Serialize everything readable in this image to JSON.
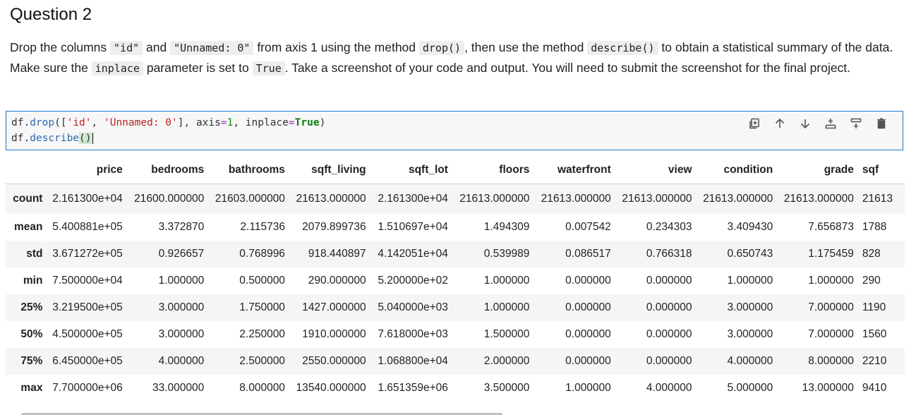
{
  "question": {
    "title": "Question 2",
    "body": {
      "t1": "Drop the columns ",
      "c1": "\"id\"",
      "t2": " and ",
      "c2": "\"Unnamed: 0\"",
      "t3": " from axis 1 using the method ",
      "c3": "drop()",
      "t4": ", then use the method ",
      "c4": "describe()",
      "t5": " to obtain a statistical summary of the data. Make sure the ",
      "c5": "inplace",
      "t6": " parameter is set to ",
      "c6": "True",
      "t7": ". Take a screenshot of your code and output. You will need to submit the screenshot for the final project."
    }
  },
  "code_cell": {
    "line1": {
      "var": "df",
      "dot": ".",
      "fn": "drop",
      "p1": "([",
      "s1": "'id'",
      "comma1": ", ",
      "s2": "'Unnamed: 0'",
      "p2": "], axis",
      "eq1": "=",
      "n1": "1",
      "p3": ", inplace",
      "eq2": "=",
      "kw": "True",
      "p4": ")"
    },
    "line2": {
      "var": "df",
      "dot": ".",
      "fn": "describe",
      "p1": "()"
    },
    "toolbar": [
      {
        "name": "duplicate-cell-button",
        "icon": "duplicate-icon"
      },
      {
        "name": "move-up-button",
        "icon": "arrow-up-icon"
      },
      {
        "name": "move-down-button",
        "icon": "arrow-down-icon"
      },
      {
        "name": "insert-above-button",
        "icon": "insert-above-icon"
      },
      {
        "name": "insert-below-button",
        "icon": "insert-below-icon"
      },
      {
        "name": "delete-cell-button",
        "icon": "trash-icon"
      }
    ]
  },
  "output_table": {
    "columns": [
      "",
      "price",
      "bedrooms",
      "bathrooms",
      "sqft_living",
      "sqft_lot",
      "floors",
      "waterfront",
      "view",
      "condition",
      "grade",
      "sqf"
    ],
    "rows": [
      {
        "label": "count",
        "values": [
          "2.161300e+04",
          "21600.000000",
          "21603.000000",
          "21613.000000",
          "2.161300e+04",
          "21613.000000",
          "21613.000000",
          "21613.000000",
          "21613.000000",
          "21613.000000",
          "21613"
        ]
      },
      {
        "label": "mean",
        "values": [
          "5.400881e+05",
          "3.372870",
          "2.115736",
          "2079.899736",
          "1.510697e+04",
          "1.494309",
          "0.007542",
          "0.234303",
          "3.409430",
          "7.656873",
          "1788"
        ]
      },
      {
        "label": "std",
        "values": [
          "3.671272e+05",
          "0.926657",
          "0.768996",
          "918.440897",
          "4.142051e+04",
          "0.539989",
          "0.086517",
          "0.766318",
          "0.650743",
          "1.175459",
          "828"
        ]
      },
      {
        "label": "min",
        "values": [
          "7.500000e+04",
          "1.000000",
          "0.500000",
          "290.000000",
          "5.200000e+02",
          "1.000000",
          "0.000000",
          "0.000000",
          "1.000000",
          "1.000000",
          "290"
        ]
      },
      {
        "label": "25%",
        "values": [
          "3.219500e+05",
          "3.000000",
          "1.750000",
          "1427.000000",
          "5.040000e+03",
          "1.000000",
          "0.000000",
          "0.000000",
          "3.000000",
          "7.000000",
          "1190"
        ]
      },
      {
        "label": "50%",
        "values": [
          "4.500000e+05",
          "3.000000",
          "2.250000",
          "1910.000000",
          "7.618000e+03",
          "1.500000",
          "0.000000",
          "0.000000",
          "3.000000",
          "7.000000",
          "1560"
        ]
      },
      {
        "label": "75%",
        "values": [
          "6.450000e+05",
          "4.000000",
          "2.500000",
          "2550.000000",
          "1.068800e+04",
          "2.000000",
          "0.000000",
          "0.000000",
          "4.000000",
          "8.000000",
          "2210"
        ]
      },
      {
        "label": "max",
        "values": [
          "7.700000e+06",
          "33.000000",
          "8.000000",
          "13540.000000",
          "1.651359e+06",
          "3.500000",
          "1.000000",
          "4.000000",
          "5.000000",
          "13.000000",
          "9410"
        ]
      }
    ]
  },
  "colors": {
    "cell_border": "#1976d2",
    "string": "#ba2121",
    "number": "#128912",
    "function": "#2b6cb0"
  }
}
